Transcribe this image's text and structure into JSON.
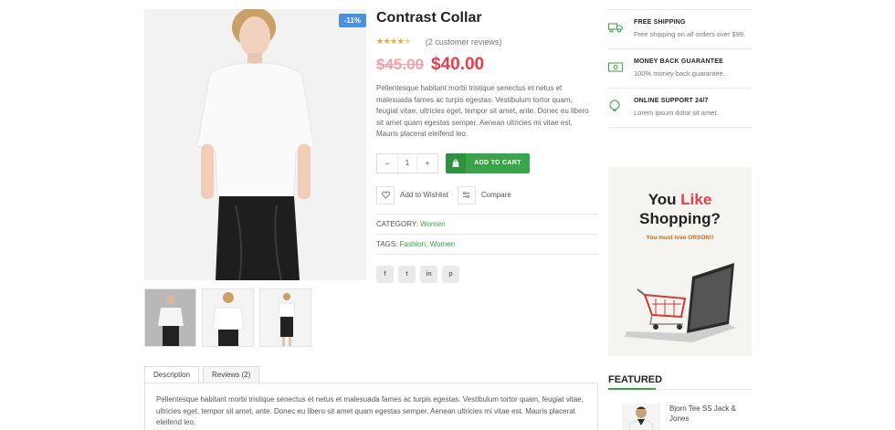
{
  "product": {
    "badge": "-11%",
    "title": "Contrast Collar",
    "rating": 4.5,
    "reviews_text": "(2 customer reviews)",
    "old_price": "$45.00",
    "new_price": "$40.00",
    "description": "Pellentesque habitant morbi tristique senectus et netus et malesuada fames ac turpis egestas. Vestibulum tortor quam, feugiat vitae, ultricies eget, tempor sit amet, ante. Donec eu libero sit amet quam egestas semper. Aenean ultricies mi vitae est. Mauris placerat eleifend leo.",
    "quantity": "1",
    "qty_minus": "−",
    "qty_plus": "+",
    "add_to_cart": "ADD TO CART",
    "wishlist": "Add to Wishlist",
    "compare": "Compare",
    "category_label": "CATEGORY:",
    "category_value": "Women",
    "tags_label": "TAGS:",
    "tag_1": "Fashion",
    "tag_sep": ",",
    "tag_2": "Women",
    "social": [
      "f",
      "t",
      "in",
      "p"
    ]
  },
  "features": [
    {
      "icon": "truck-icon",
      "title": "FREE SHIPPING",
      "text": "Free shipping on all orders over $99."
    },
    {
      "icon": "money-icon",
      "title": "MONEY BACK GUARANTEE",
      "text": "100% money back guarantee."
    },
    {
      "icon": "support-icon",
      "title": "ONLINE SUPPORT 24/7",
      "text": "Lorem ipsum dolor sit amet."
    }
  ],
  "banner": {
    "line1_a": "You ",
    "line1_b": "Like",
    "line2": "Shopping?",
    "sub": "You must love ORSON!!"
  },
  "featured": {
    "heading": "FEATURED",
    "item_name": "Bjorn Tee SS Jack & Jones"
  },
  "tabs": {
    "description": "Description",
    "reviews": "Reviews (2)",
    "panel_text": "Pellentesque habitant morbi tristique senectus et netus et malesuada fames ac turpis egestas. Vestibulum tortor quam, feugiat vitae, ultricies eget, tempor sit amet, ante. Donec eu libero sit amet quam egestas semper. Aenean ultricies mi vitae est. Mauris placerat eleifend leo."
  },
  "colors": {
    "accent_green": "#3aa34b",
    "price_red": "#e53e4c",
    "badge_blue": "#4a90e2",
    "star": "#f5a623"
  }
}
